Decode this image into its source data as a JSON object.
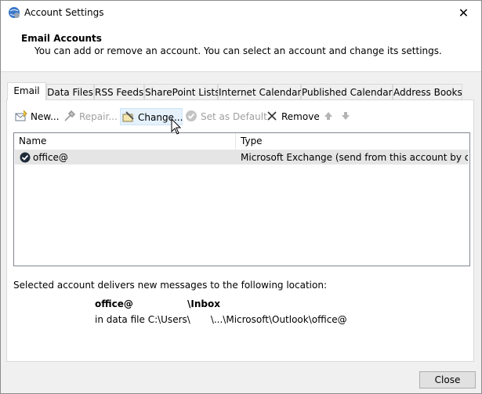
{
  "window": {
    "title": "Account Settings",
    "close_glyph": "✕",
    "icon": "settings-globe-icon"
  },
  "header": {
    "title": "Email Accounts",
    "description": "You can add or remove an account. You can select an account and change its settings."
  },
  "tabs": [
    {
      "label": "Email",
      "active": true
    },
    {
      "label": "Data Files"
    },
    {
      "label": "RSS Feeds"
    },
    {
      "label": "SharePoint Lists"
    },
    {
      "label": "Internet Calendars"
    },
    {
      "label": "Published Calendars"
    },
    {
      "label": "Address Books"
    }
  ],
  "toolbar": {
    "new": "New...",
    "repair": "Repair...",
    "change": "Change...",
    "set_default": "Set as Default",
    "remove": "Remove"
  },
  "list": {
    "columns": [
      "Name",
      "Type"
    ],
    "rows": [
      {
        "name": "office@",
        "type": "Microsoft Exchange (send from this account by def..."
      }
    ]
  },
  "location": {
    "intro": "Selected account delivers new messages to the following location:",
    "account": "office@",
    "folder": "\\Inbox",
    "file_prefix": "in data file C:\\Users\\",
    "file_path": "\\...\\Microsoft\\Outlook\\office@"
  },
  "footer": {
    "close": "Close"
  },
  "colors": {
    "dialog_bg": "#f0f0f0",
    "selected_row": "#e5e5e5",
    "disabled_text": "#a0a0a0"
  }
}
